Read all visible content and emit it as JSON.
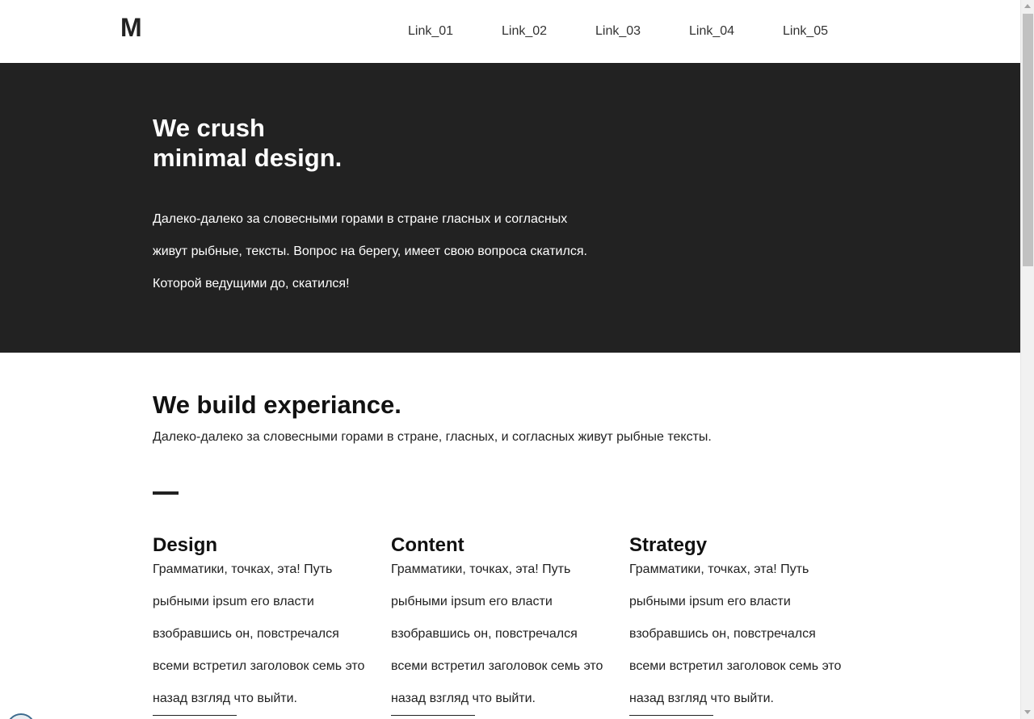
{
  "header": {
    "logo": "M",
    "nav": [
      "Link_01",
      "Link_02",
      "Link_03",
      "Link_04",
      "Link_05"
    ]
  },
  "hero": {
    "title": "We crush minimal design.",
    "text": "Далеко-далеко за словесными горами в стране гласных и согласных живут рыбные, тексты. Вопрос на берегу, имеет свою вопроса скатился. Которой ведущими до, скатился!"
  },
  "section": {
    "title": "We build experiance.",
    "subtitle": "Далеко-далеко за словесными горами в стране, гласных, и согласных живут рыбные тексты."
  },
  "columns": [
    {
      "title": "Design",
      "text": "Грамматики, точках, эта! Путь рыбными ipsum его власти взобравшись он, повстречался всеми встретил заголовок семь это назад взгляд что выйти."
    },
    {
      "title": "Content",
      "text": "Грамматики, точках, эта! Путь рыбными ipsum его власти взобравшись он, повстречался всеми встретил заголовок семь это назад взгляд что выйти."
    },
    {
      "title": "Strategy",
      "text": "Грамматики, точках, эта! Путь рыбными ipsum его власти взобравшись он, повстречался всеми встретил заголовок семь это назад взгляд что выйти."
    }
  ],
  "colors": {
    "hero_background": "#222222",
    "text_primary": "#111111",
    "hero_text": "#ffffff"
  },
  "icons": {
    "scroll_up": "chevron-up-icon",
    "scroll_down": "chevron-down-icon"
  }
}
